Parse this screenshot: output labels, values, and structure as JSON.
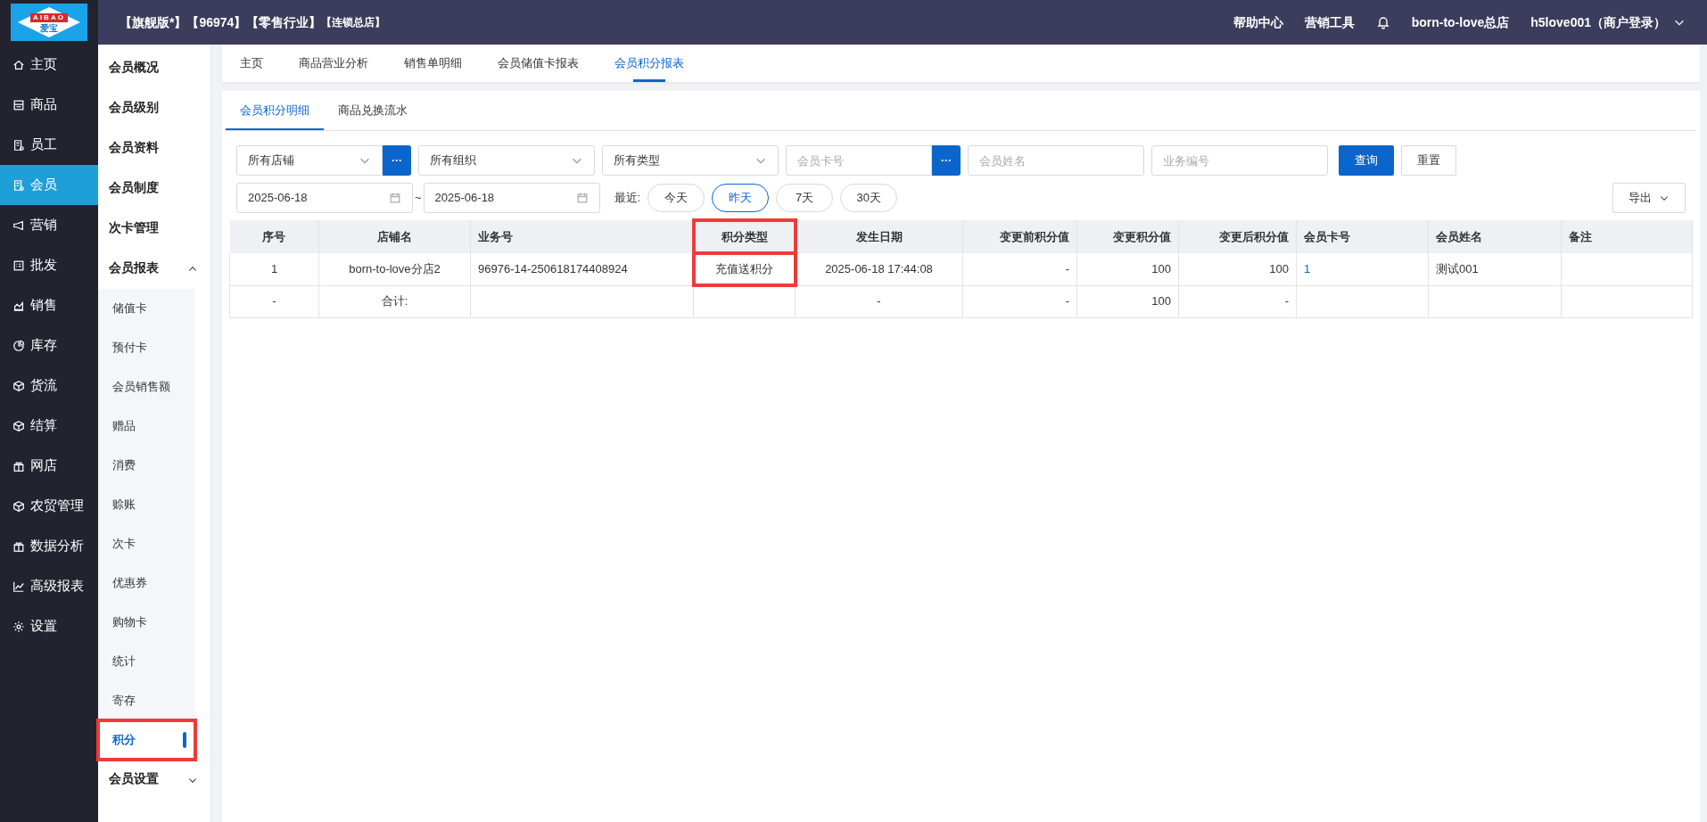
{
  "logo": {
    "text": "AIBAO",
    "subtext": "爱宝"
  },
  "header": {
    "edition": "【旗舰版*】",
    "account": "【96974】",
    "industry": "【零售行业】",
    "store_type": "【连锁总店】",
    "links": [
      "帮助中心",
      "营销工具"
    ],
    "store": "born-to-love总店",
    "user": "h5love001（商户登录）"
  },
  "nav": [
    {
      "label": "主页",
      "selected": false
    },
    {
      "label": "商品",
      "selected": false
    },
    {
      "label": "员工",
      "selected": false
    },
    {
      "label": "会员",
      "selected": true
    },
    {
      "label": "营销",
      "selected": false
    },
    {
      "label": "批发",
      "selected": false
    },
    {
      "label": "销售",
      "selected": false
    },
    {
      "label": "库存",
      "selected": false
    },
    {
      "label": "货流",
      "selected": false
    },
    {
      "label": "结算",
      "selected": false
    },
    {
      "label": "网店",
      "selected": false
    },
    {
      "label": "农贸管理",
      "selected": false
    },
    {
      "label": "数据分析",
      "selected": false
    },
    {
      "label": "高级报表",
      "selected": false
    },
    {
      "label": "设置",
      "selected": false
    }
  ],
  "subnav": [
    {
      "label": "会员概况",
      "kind": "item"
    },
    {
      "label": "会员级别",
      "kind": "item"
    },
    {
      "label": "会员资料",
      "kind": "item"
    },
    {
      "label": "会员制度",
      "kind": "item"
    },
    {
      "label": "次卡管理",
      "kind": "item"
    },
    {
      "label": "会员报表",
      "kind": "group",
      "expanded": true,
      "children": [
        {
          "label": "储值卡",
          "selected": false
        },
        {
          "label": "预付卡",
          "selected": false
        },
        {
          "label": "会员销售额",
          "selected": false
        },
        {
          "label": "赠品",
          "selected": false
        },
        {
          "label": "消费",
          "selected": false
        },
        {
          "label": "赊账",
          "selected": false
        },
        {
          "label": "次卡",
          "selected": false
        },
        {
          "label": "优惠券",
          "selected": false
        },
        {
          "label": "购物卡",
          "selected": false
        },
        {
          "label": "统计",
          "selected": false
        },
        {
          "label": "寄存",
          "selected": false
        },
        {
          "label": "积分",
          "selected": true,
          "highlighted": true
        }
      ]
    },
    {
      "label": "会员设置",
      "kind": "group",
      "expanded": false
    }
  ],
  "tabs": [
    {
      "label": "主页",
      "selected": false
    },
    {
      "label": "商品营业分析",
      "selected": false
    },
    {
      "label": "销售单明细",
      "selected": false
    },
    {
      "label": "会员储值卡报表",
      "selected": false
    },
    {
      "label": "会员积分报表",
      "selected": true
    }
  ],
  "subtabs": [
    {
      "label": "会员积分明细",
      "selected": true
    },
    {
      "label": "商品兑换流水",
      "selected": false
    }
  ],
  "filters": [
    {
      "kind": "select",
      "value": "所有店铺",
      "lookup": "···"
    },
    {
      "kind": "select",
      "value": "所有组织"
    },
    {
      "kind": "select",
      "value": "所有类型"
    },
    {
      "kind": "input",
      "placeholder": "会员卡号",
      "lookup": "···"
    },
    {
      "kind": "input",
      "placeholder": "会员姓名"
    },
    {
      "kind": "input",
      "placeholder": "业务编号"
    }
  ],
  "query_button": "查询",
  "reset_button": "重置",
  "date_from": "2025-06-18",
  "date_sep": "~",
  "date_to": "2025-06-18",
  "recent_label": "最近:",
  "recent": [
    {
      "label": "今天",
      "selected": false
    },
    {
      "label": "昨天",
      "selected": true
    },
    {
      "label": "7天",
      "selected": false
    },
    {
      "label": "30天",
      "selected": false
    }
  ],
  "export_button": "导出",
  "table": {
    "columns": [
      {
        "label": "序号"
      },
      {
        "label": "店铺名"
      },
      {
        "label": "业务号"
      },
      {
        "label": "积分类型",
        "highlighted": true
      },
      {
        "label": "发生日期"
      },
      {
        "label": "变更前积分值"
      },
      {
        "label": "变更积分值"
      },
      {
        "label": "变更后积分值"
      },
      {
        "label": "会员卡号"
      },
      {
        "label": "会员姓名"
      },
      {
        "label": "备注"
      }
    ],
    "rows": [
      [
        "1",
        "born-to-love分店2",
        "96976-14-250618174408924",
        "充值送积分",
        "2025-06-18 17:44:08",
        "-",
        "100",
        "100",
        "1",
        "测试001",
        ""
      ],
      [
        "-",
        "合计:",
        "",
        "",
        "-",
        "-",
        "100",
        "-",
        "",
        "",
        ""
      ]
    ]
  }
}
